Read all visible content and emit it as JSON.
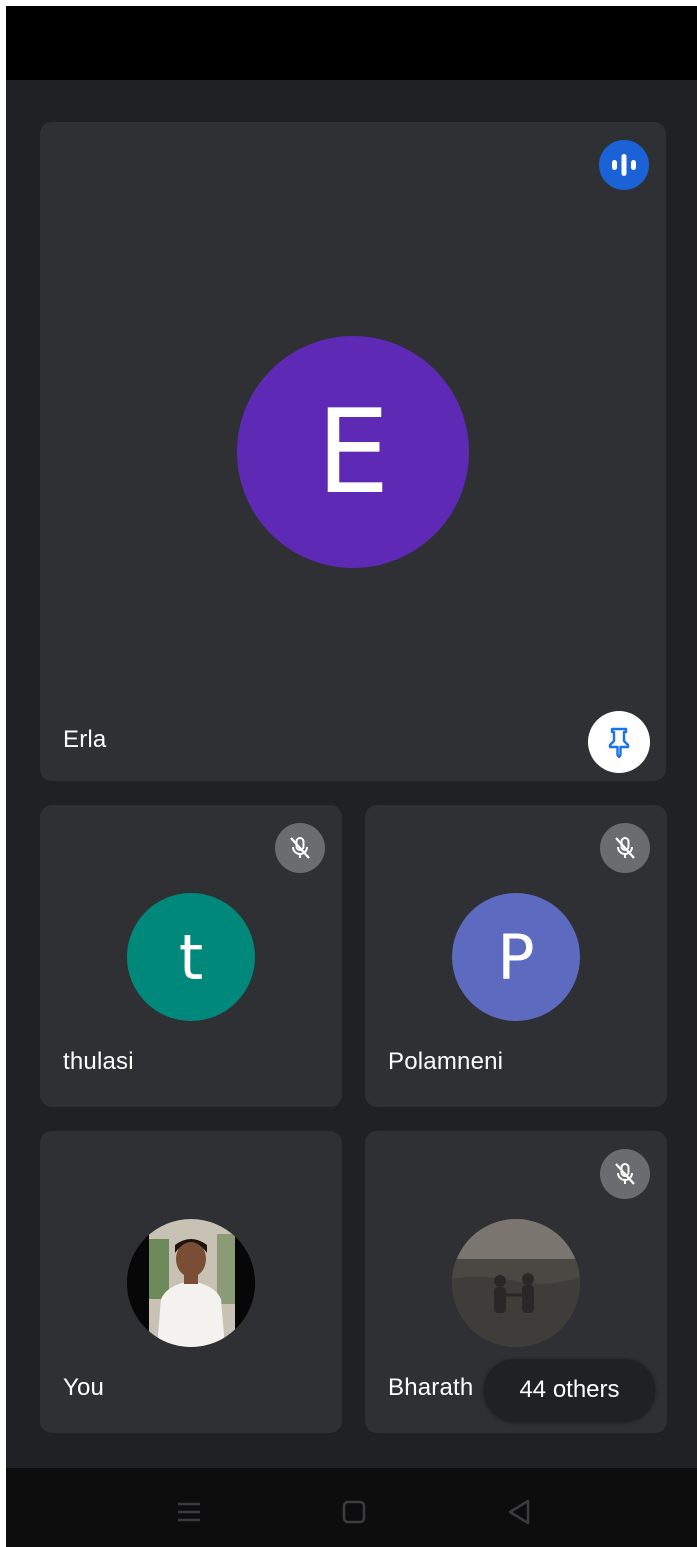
{
  "main_participant": {
    "name": "Erla",
    "initial": "E",
    "avatar_color": "#5e2ab5",
    "speaking_icon": "audio-level-icon",
    "pin_icon": "pin-icon"
  },
  "participants": [
    {
      "name": "thulasi",
      "initial": "t",
      "avatar_color": "#00897b",
      "muted": true
    },
    {
      "name": "Polamneni",
      "initial": "P",
      "avatar_color": "#5c6bc0",
      "muted": true
    },
    {
      "name": "You",
      "avatar": "profile-photo",
      "muted": false
    },
    {
      "name": "Bharath",
      "avatar": "profile-photo",
      "muted": true
    }
  ],
  "others_chip": {
    "label": "44 others"
  },
  "nav": {
    "icons": [
      "recent-apps-icon",
      "home-icon",
      "back-icon"
    ]
  },
  "colors": {
    "background": "#202124",
    "tile": "#2f3033",
    "speaking_badge": "#1a62d6",
    "mute_badge": "#6b6c70"
  }
}
